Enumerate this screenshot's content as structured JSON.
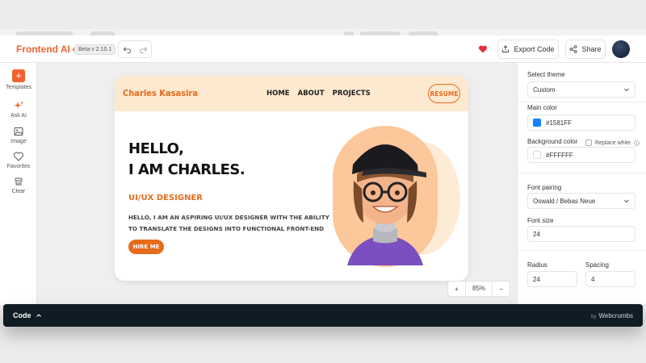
{
  "app": {
    "brand": "Frontend AI",
    "version": "Beta v 2.10.1"
  },
  "toolbar": {
    "export_label": "Export Code",
    "share_label": "Share"
  },
  "sidebar": {
    "items": [
      {
        "label": "Templates",
        "icon": "plus-icon"
      },
      {
        "label": "Ask AI",
        "icon": "sparkle-icon"
      },
      {
        "label": "Image",
        "icon": "image-icon"
      },
      {
        "label": "Favorites",
        "icon": "heart-icon"
      },
      {
        "label": "Clear",
        "icon": "clear-icon"
      }
    ]
  },
  "preview": {
    "logo": "Charles Kasasira",
    "nav": [
      "HOME",
      "ABOUT",
      "PROJECTS"
    ],
    "resume": "RESUME",
    "hello_line1": "HELLO,",
    "hello_line2": "I AM CHARLES.",
    "role": "UI/UX DESIGNER",
    "description": "HELLO, I AM AN ASPIRING UI/UX DESIGNER WITH THE ABILITY TO TRANSLATE THE DESIGNS INTO FUNCTIONAL FRONT-END",
    "hire": "HIRE ME"
  },
  "zoom": {
    "plus": "+",
    "value": "85%",
    "minus": "−"
  },
  "settings": {
    "theme_label": "Select theme",
    "theme_value": "Custom",
    "main_color_label": "Main color",
    "main_color_value": "#1581FF",
    "bg_color_label": "Background color",
    "replace_white_label": "Replace white",
    "bg_color_value": "#FFFFFF",
    "font_pairing_label": "Font pairing",
    "font_pairing_value": "Oswald / Bebas Neue",
    "font_size_label": "Font size",
    "font_size_value": "24",
    "radius_label": "Radius",
    "radius_value": "24",
    "spacing_label": "Spacing",
    "spacing_value": "4"
  },
  "code_bar": {
    "label": "Code",
    "by": "by",
    "credit": "Webcrumbs"
  },
  "colors": {
    "brand": "#f2622e",
    "accent_orange": "#e66b1c",
    "peach": "#fde9cf",
    "main_color": "#1581FF",
    "bg_color": "#FFFFFF",
    "code_bar": "#0f1c24"
  }
}
